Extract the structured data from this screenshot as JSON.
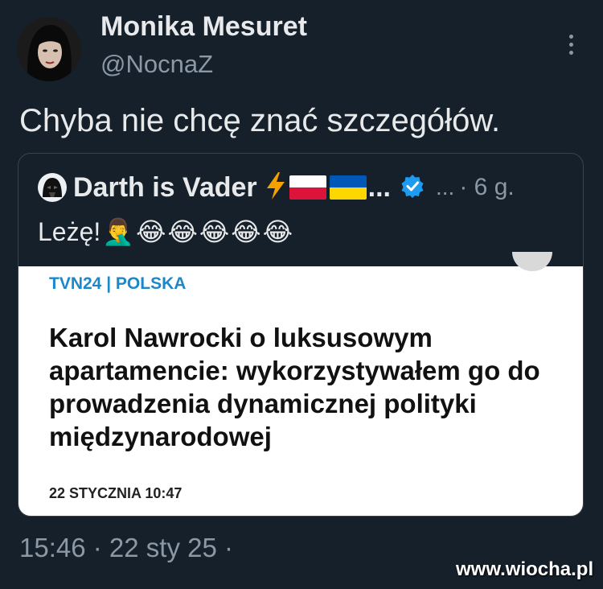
{
  "tweet": {
    "author_name": "Monika Mesuret",
    "author_handle": "@NocnaZ",
    "text": "Chyba nie chcę znać szczegółów.",
    "timestamp": "15:46 · 22 sty 25 ·",
    "icons": {
      "more": "more-vertical-icon",
      "avatar": "avatar"
    }
  },
  "quote": {
    "author_name": "Darth is Vader",
    "name_ellipsis": "...",
    "handle": "...",
    "time": "· 6 g.",
    "text": "Leżę!",
    "emojis": [
      "🤦‍♂️",
      "😂",
      "😂",
      "😂",
      "😂",
      "😂"
    ],
    "icons": {
      "bolt": "lightning-icon",
      "flag1": "poland-flag-icon",
      "flag2": "ukraine-flag-icon",
      "verified": "verified-badge-icon"
    },
    "colors": {
      "verified": "#1d9bf0",
      "bolt": "#f4a100"
    }
  },
  "card": {
    "source": "TVN24 | POLSKA",
    "headline": "Karol Nawrocki o luksusowym apartamencie: wykorzystywałem go do prowadzenia dynamicznej polityki międzynarodowej",
    "date": "22 STYCZNIA 10:47",
    "colors": {
      "source": "#1d88c9"
    }
  },
  "watermark": "www.wiocha.pl"
}
